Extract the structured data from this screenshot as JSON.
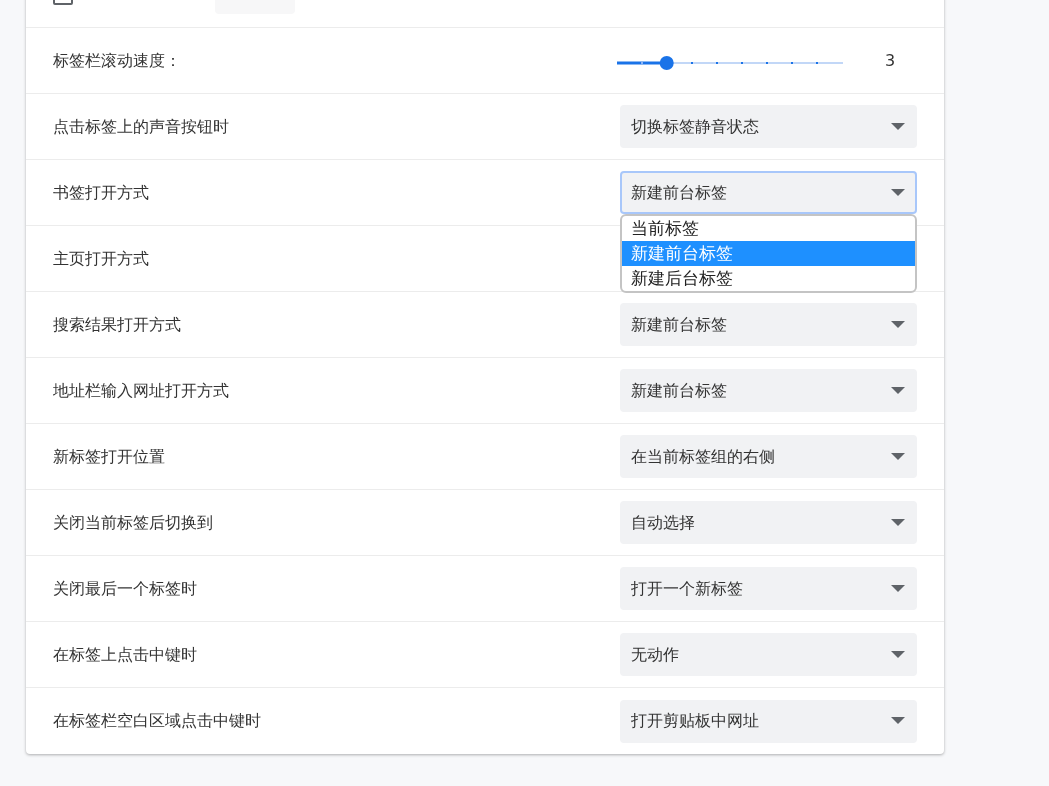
{
  "rows": [
    {
      "kind": "checkbox",
      "checked": false
    },
    {
      "kind": "slider",
      "label": "标签栏滚动速度：",
      "level": 0.22,
      "reading": "3"
    },
    {
      "kind": "select",
      "label": "点击标签上的声音按钮时",
      "value": "切换标签静音状态",
      "expanded": false
    },
    {
      "kind": "select",
      "label": "书签打开方式",
      "value": "新建前台标签",
      "expanded": true,
      "options": [
        {
          "label": "当前标签",
          "selected": false
        },
        {
          "label": "新建前台标签",
          "selected": true
        },
        {
          "label": "新建后台标签",
          "selected": false
        }
      ]
    },
    {
      "kind": "select",
      "label": "主页打开方式"
    },
    {
      "kind": "select",
      "label": "搜索结果打开方式",
      "value": "新建前台标签",
      "expanded": false
    },
    {
      "kind": "select",
      "label": "地址栏输入网址打开方式",
      "value": "新建前台标签",
      "expanded": false
    },
    {
      "kind": "select",
      "label": "新标签打开位置",
      "value": "在当前标签组的右侧",
      "expanded": false
    },
    {
      "kind": "select",
      "label": "关闭当前标签后切换到",
      "value": "自动选择",
      "expanded": false
    },
    {
      "kind": "select",
      "label": "关闭最后一个标签时",
      "value": "打开一个新标签",
      "expanded": false
    },
    {
      "kind": "select",
      "label": "在标签上点击中键时",
      "value": "无动作",
      "expanded": false
    },
    {
      "kind": "select",
      "label": "在标签栏空白区域点击中键时",
      "value": "打开剪贴板中网址",
      "expanded": false
    }
  ]
}
